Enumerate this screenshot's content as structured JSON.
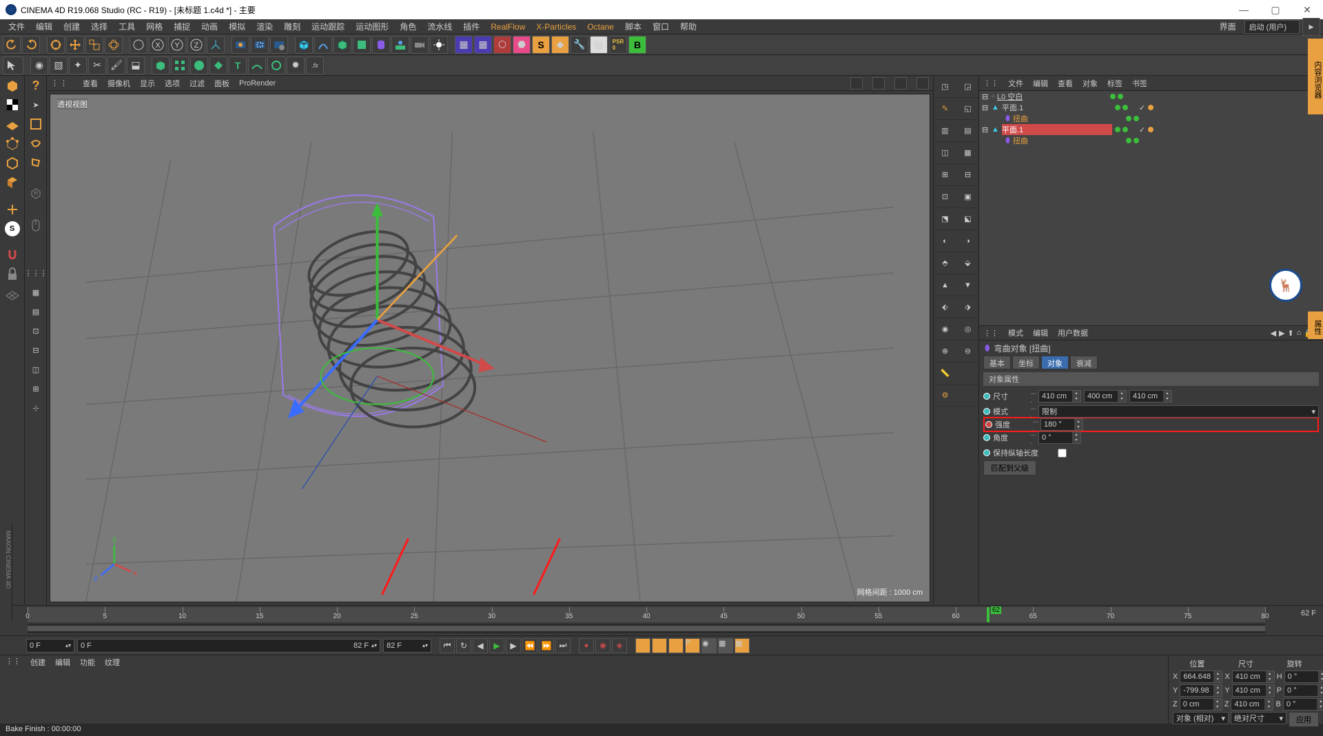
{
  "titlebar": {
    "text": "CINEMA 4D R19.068 Studio (RC - R19) - [未标题 1.c4d *] - 主要"
  },
  "menubar": {
    "items": [
      "文件",
      "编辑",
      "创建",
      "选择",
      "工具",
      "网格",
      "捕捉",
      "动画",
      "模拟",
      "渲染",
      "雕刻",
      "运动跟踪",
      "运动图形",
      "角色",
      "流水线",
      "插件"
    ],
    "plugins": [
      "RealFlow",
      "X-Particles",
      "Octane"
    ],
    "tail": [
      "脚本",
      "窗口",
      "帮助"
    ],
    "layout_label": "界面",
    "layout_value": "启动 (用户)"
  },
  "viewport": {
    "menu": [
      "查看",
      "摄像机",
      "显示",
      "选项",
      "过滤",
      "面板",
      "ProRender"
    ],
    "label": "透视视图",
    "grid_info": "网格间距 : 1000 cm"
  },
  "timeline": {
    "frame_current": "62 F",
    "frame_start": "0 F",
    "frame_alt": "0 F",
    "frame_mid": "82 F",
    "frame_end": "82 F",
    "playhead": "62",
    "ticks": [
      "0",
      "5",
      "10",
      "15",
      "20",
      "25",
      "30",
      "35",
      "40",
      "45",
      "50",
      "55",
      "60",
      "65",
      "70",
      "75",
      "80"
    ]
  },
  "bottom_tabs": [
    "创建",
    "编辑",
    "功能",
    "纹理"
  ],
  "coord": {
    "headers": [
      "位置",
      "尺寸",
      "旋转"
    ],
    "rows": [
      {
        "axis": "X",
        "pos": "664.648 cm",
        "size_ax": "X",
        "size": "410 cm",
        "rot_ax": "H",
        "rot": "0 °"
      },
      {
        "axis": "Y",
        "pos": "-799.98 cm",
        "size_ax": "Y",
        "size": "410 cm",
        "rot_ax": "P",
        "rot": "0 °"
      },
      {
        "axis": "Z",
        "pos": "0 cm",
        "size_ax": "Z",
        "size": "410 cm",
        "rot_ax": "B",
        "rot": "0 °"
      }
    ],
    "mode1": "对象 (相对)",
    "mode2": "绝对尺寸",
    "apply": "应用"
  },
  "obj_panel": {
    "tabs": [
      "文件",
      "编辑",
      "查看",
      "对象",
      "标签",
      "书签"
    ],
    "tree": [
      {
        "indent": 0,
        "exp": "⊟",
        "icon": "layer",
        "name": "L0 空白",
        "vis": [
          "green",
          "green"
        ],
        "tags": []
      },
      {
        "indent": 0,
        "exp": "⊟",
        "icon": "plane",
        "name": "平面.1",
        "vis": [
          "green",
          "green"
        ],
        "tags": [
          "check",
          "orange"
        ]
      },
      {
        "indent": 1,
        "exp": "",
        "icon": "deform",
        "name": "扭曲",
        "vis": [
          "green",
          "green"
        ],
        "tags": []
      },
      {
        "indent": 0,
        "exp": "⊟",
        "icon": "plane",
        "name": "平面.1",
        "vis": [
          "green",
          "green"
        ],
        "tags": [
          "check",
          "orange"
        ]
      },
      {
        "indent": 1,
        "exp": "",
        "icon": "deform",
        "name": "扭曲",
        "vis": [
          "green",
          "green"
        ],
        "tags": []
      }
    ]
  },
  "attr": {
    "tabs": [
      "模式",
      "编辑",
      "用户数据"
    ],
    "title": "弯曲对象 [扭曲]",
    "subtabs": [
      "基本",
      "坐标",
      "对象",
      "衰减"
    ],
    "section": "对象属性",
    "props": {
      "size_label": "尺寸",
      "size": [
        "410 cm",
        "400 cm",
        "410 cm"
      ],
      "mode_label": "模式",
      "mode_value": "限制",
      "strength_label": "强度",
      "strength_value": "180 °",
      "angle_label": "角度",
      "angle_value": "0 °",
      "keep_label": "保持纵轴长度",
      "fit_btn": "匹配到父级"
    }
  },
  "status": "Bake Finish : 00:00:00",
  "side_tab1": "内容浏览器",
  "side_tab2": "属性"
}
